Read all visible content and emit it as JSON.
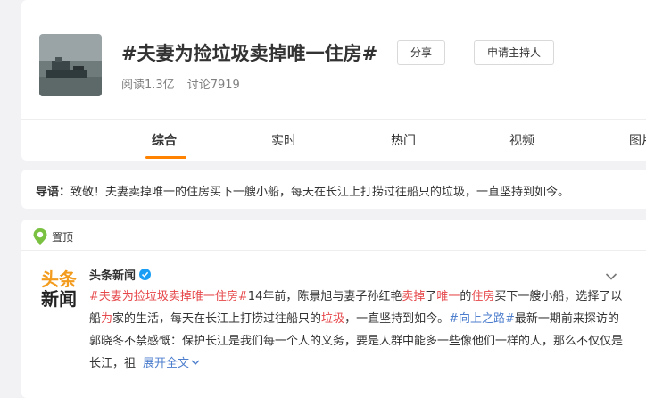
{
  "topic": {
    "title": "#夫妻为捡垃圾卖掉唯一住房#",
    "reads": "阅读1.3亿",
    "discussions": "讨论7919",
    "share_label": "分享",
    "apply_host_label": "申请主持人"
  },
  "tabs": [
    {
      "label": "综合",
      "active": true
    },
    {
      "label": "实时"
    },
    {
      "label": "热门"
    },
    {
      "label": "视频"
    },
    {
      "label": "图片"
    }
  ],
  "intro": {
    "label": "导语：",
    "text": "致敬！夫妻卖掉唯一的住房买下一艘小船，每天在长江上打捞过往船只的垃圾，一直坚持到如今。"
  },
  "post": {
    "pinned_label": "置顶",
    "avatar_top": "头条",
    "avatar_bottom": "新闻",
    "author": "头条新闻",
    "seg": [
      "#夫妻为捡垃圾卖掉唯一住房#",
      "14年前，陈景旭与妻子孙红艳",
      "卖掉",
      "了",
      "唯一",
      "的",
      "住房",
      "买下一艘小船，选择了以船",
      "为",
      "家的生活，每天在长江上打捞过往船只的",
      "垃圾",
      "，一直坚持到如今。",
      "#向上之路#",
      "最新一期前来探访的郭晓冬不禁感慨：保护长江是我们每一个人的义务，要是人群中能多一些像他们一样的人，那么不仅仅是长江，祖",
      "展开全文"
    ]
  },
  "colors": {
    "accent": "#ff8200",
    "highlight": "#e6474a",
    "link": "#4d7ecd",
    "verified": "#1a9ef5"
  },
  "icons": [
    "verified-badge-icon",
    "chevron-down-icon",
    "pin-icon",
    "expand-chevron-icon"
  ]
}
